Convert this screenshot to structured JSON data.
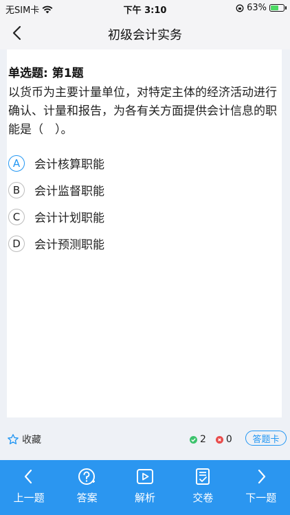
{
  "status_bar": {
    "carrier": "无SIM卡",
    "time": "下午 3:10",
    "battery": "63%",
    "battery_level": 0.63
  },
  "nav": {
    "title": "初级会计实务"
  },
  "question": {
    "type_label": "单选题: 第1题",
    "text": "以货币为主要计量单位，对特定主体的经济活动进行确认、计量和报告，为各有关方面提供会计信息的职能是（　）。",
    "options": [
      {
        "letter": "A",
        "text": "会计核算职能",
        "selected": true
      },
      {
        "letter": "B",
        "text": "会计监督职能",
        "selected": false
      },
      {
        "letter": "C",
        "text": "会计计划职能",
        "selected": false
      },
      {
        "letter": "D",
        "text": "会计预测职能",
        "selected": false
      }
    ]
  },
  "info_bar": {
    "favorite_label": "收藏",
    "correct_count": "2",
    "wrong_count": "0",
    "answer_card_label": "答题卡"
  },
  "toolbar": {
    "prev_label": "上一题",
    "answer_label": "答案",
    "analysis_label": "解析",
    "submit_label": "交卷",
    "next_label": "下一题"
  },
  "colors": {
    "accent": "#2196f3",
    "toolbar": "#2b96f0",
    "correct": "#3cc36d",
    "wrong": "#e84c4c"
  }
}
